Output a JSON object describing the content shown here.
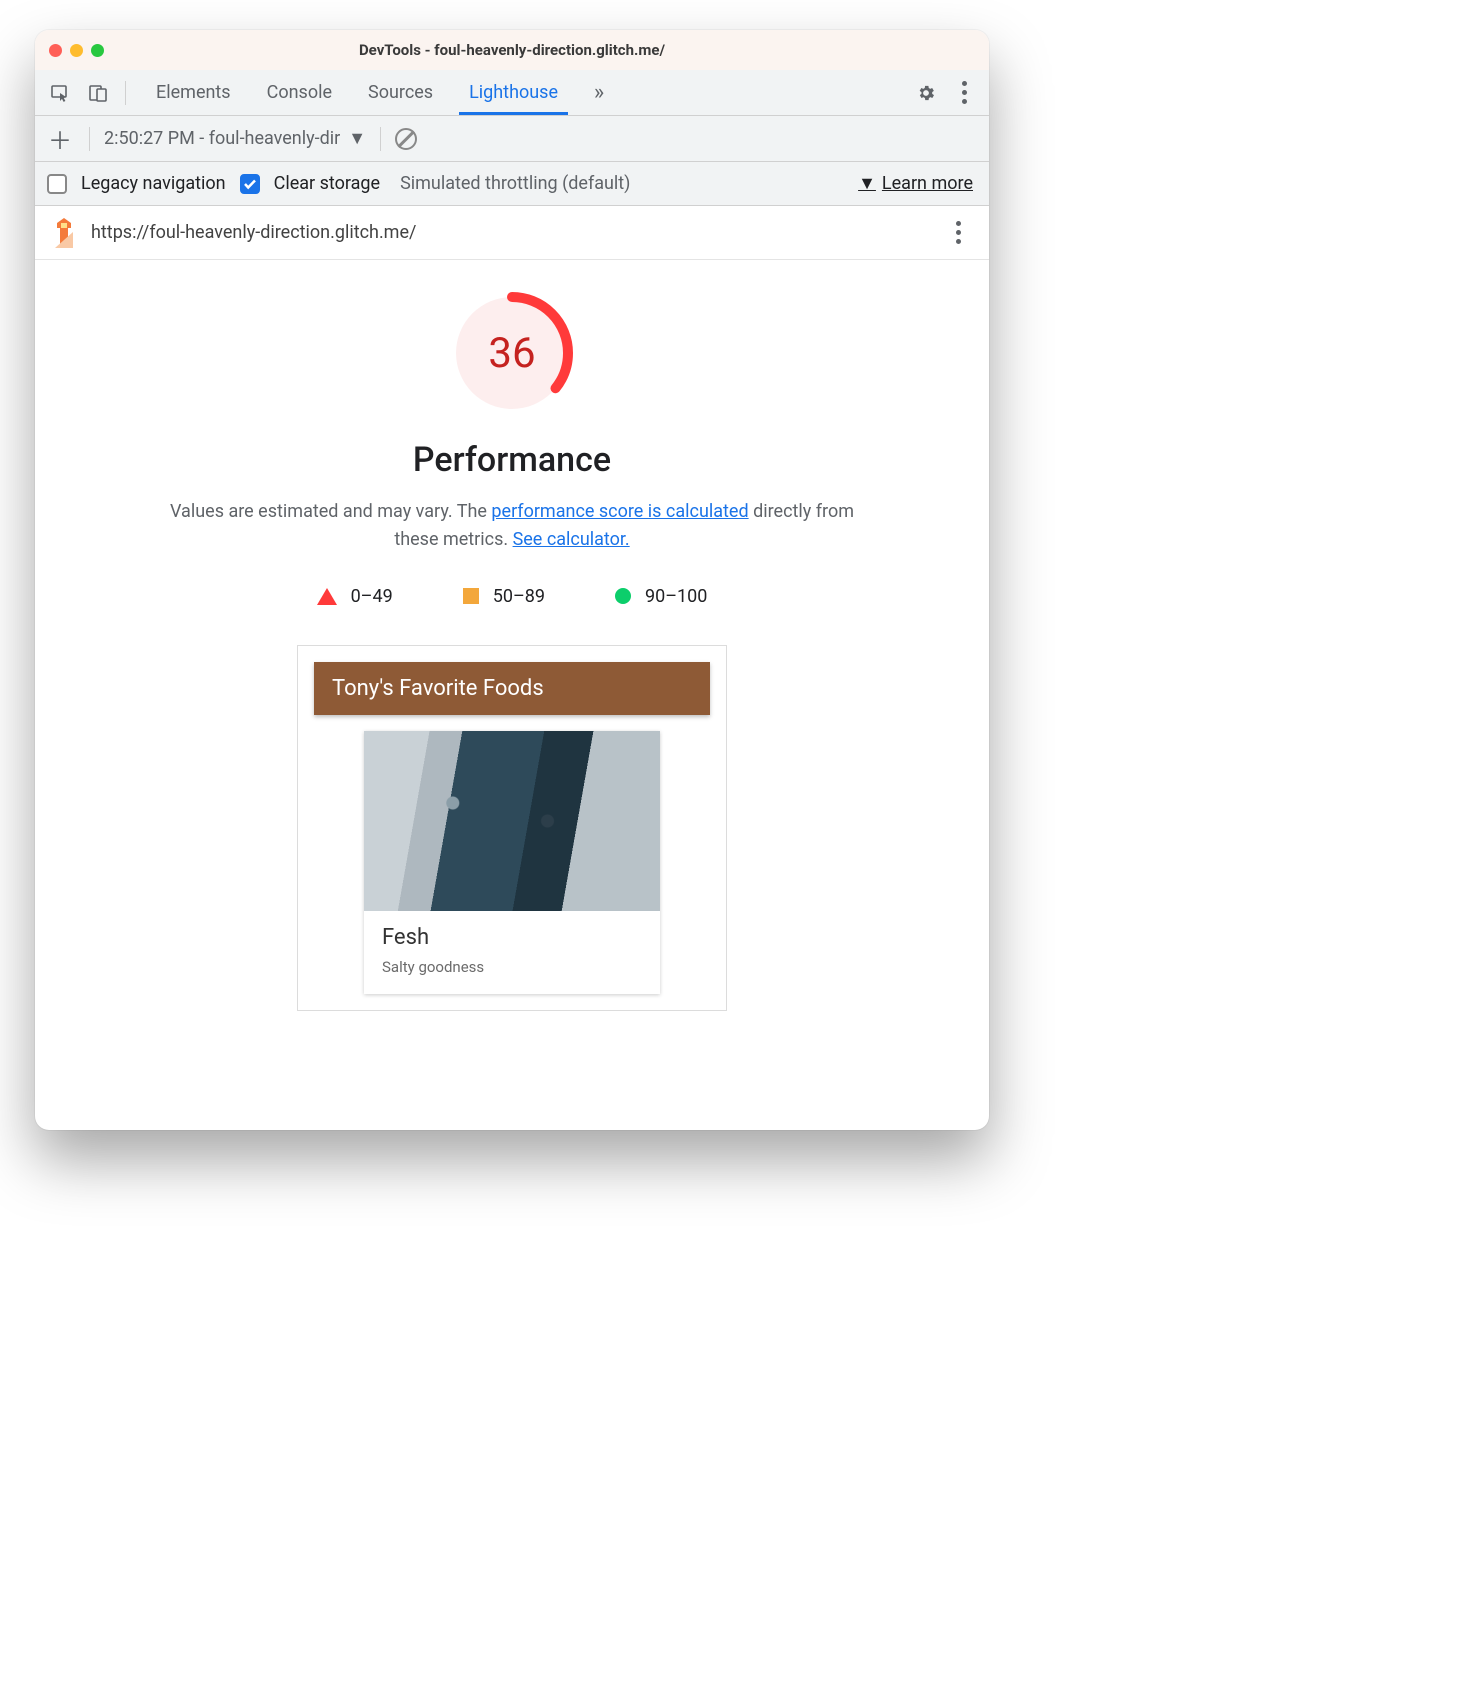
{
  "window": {
    "title": "DevTools - foul-heavenly-direction.glitch.me/"
  },
  "tabs": {
    "items": [
      "Elements",
      "Console",
      "Sources",
      "Lighthouse"
    ],
    "active": "Lighthouse"
  },
  "subbar": {
    "report_label": "2:50:27 PM - foul-heavenly-dir"
  },
  "options": {
    "legacy": {
      "label": "Legacy navigation",
      "checked": false
    },
    "clear": {
      "label": "Clear storage",
      "checked": true
    },
    "throttle": "Simulated throttling (default)",
    "learn_more": "Learn more"
  },
  "urlbar": {
    "url": "https://foul-heavenly-direction.glitch.me/"
  },
  "report": {
    "score": 36,
    "category": "Performance",
    "desc_a": "Values are estimated and may vary. The ",
    "link_a": "performance score is calculated",
    "desc_b": " directly from these metrics. ",
    "link_b": "See calculator.",
    "legend": {
      "low": "0–49",
      "mid": "50–89",
      "high": "90–100"
    }
  },
  "card": {
    "header": "Tony's Favorite Foods",
    "food_title": "Fesh",
    "food_sub": "Salty goodness"
  }
}
